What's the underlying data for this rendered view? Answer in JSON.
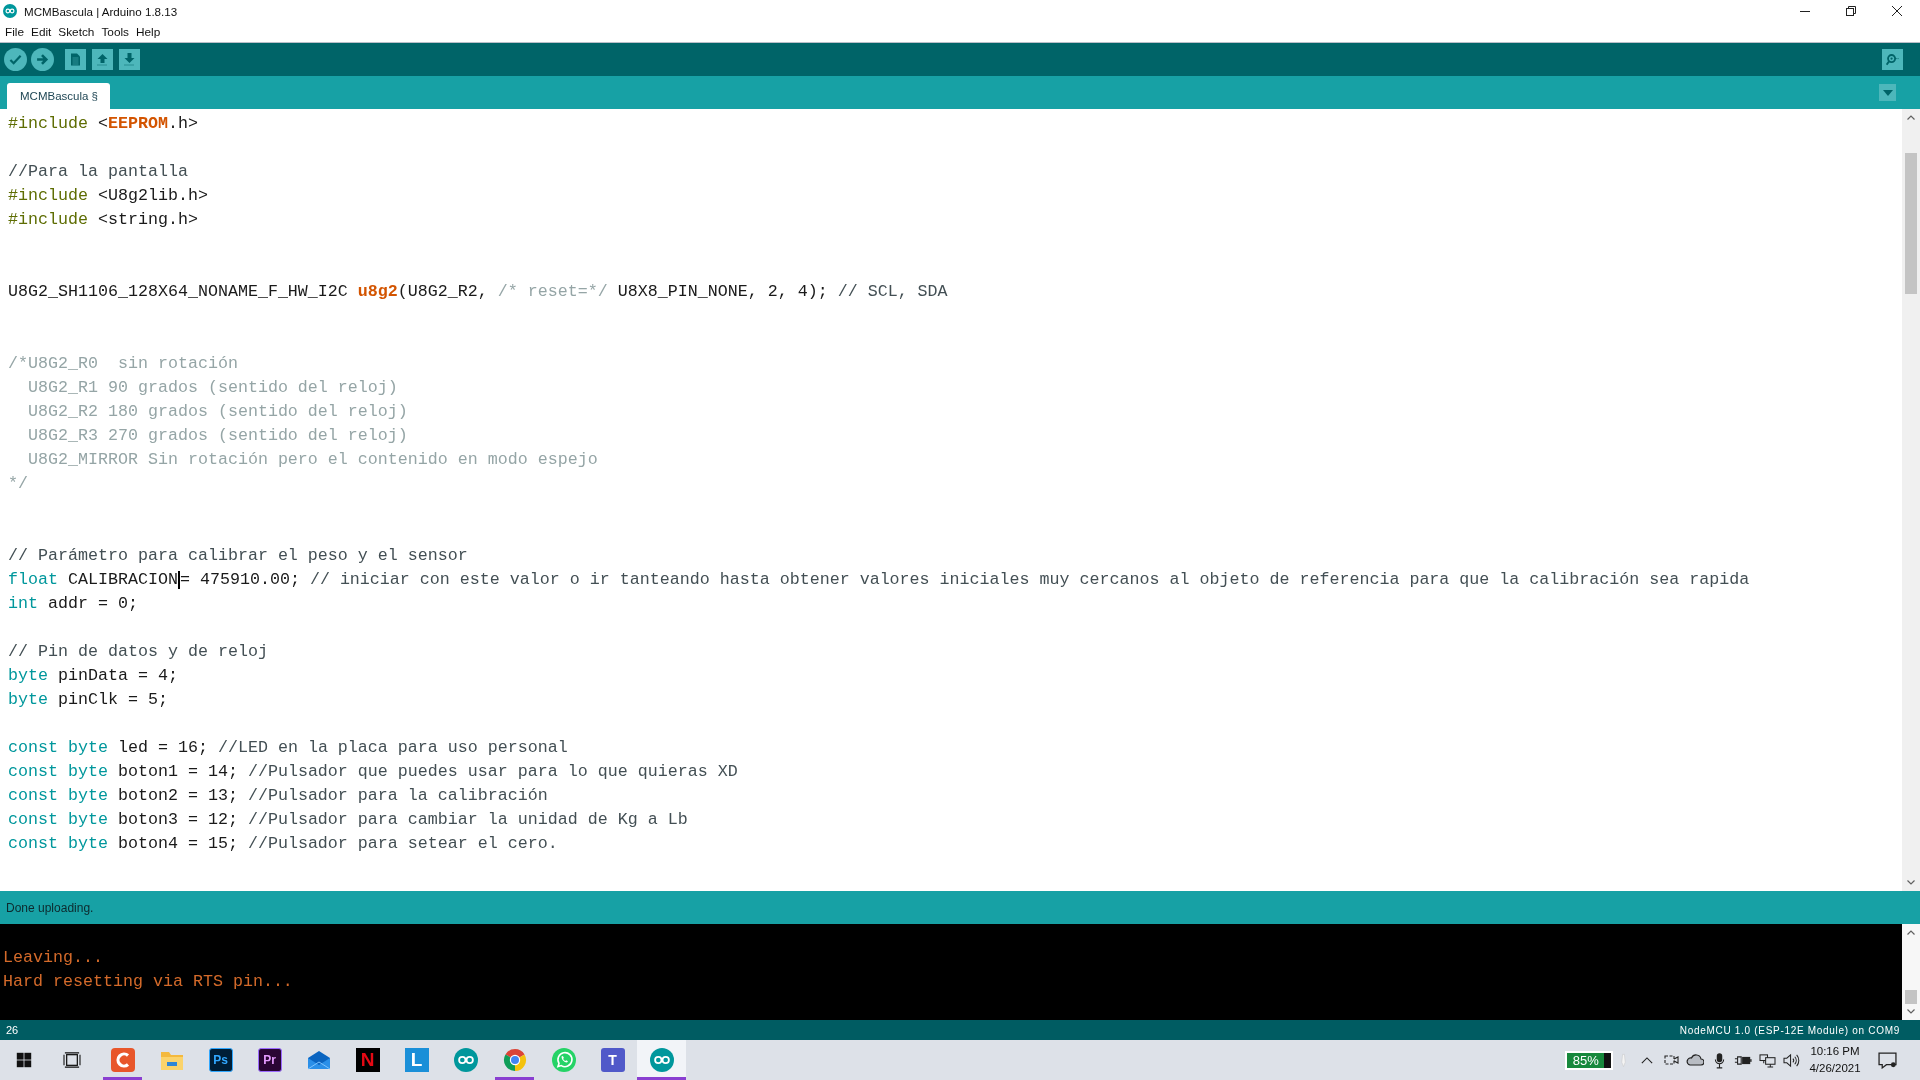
{
  "window": {
    "title": "MCMBascula | Arduino 1.8.13"
  },
  "menu": [
    "File",
    "Edit",
    "Sketch",
    "Tools",
    "Help"
  ],
  "tabs": [
    {
      "label": "MCMBascula §",
      "selected": true
    }
  ],
  "editor": {
    "lines": [
      {
        "kind": "code",
        "segments": [
          {
            "kind": "preprocessor",
            "text": "#include"
          },
          {
            "kind": "text",
            "text": " <"
          },
          {
            "kind": "emphasis",
            "text": "EEPROM"
          },
          {
            "kind": "text",
            "text": ".h>"
          }
        ]
      },
      {
        "kind": "blank"
      },
      {
        "kind": "code",
        "segments": [
          {
            "kind": "comment",
            "text": "//Para la pantalla"
          }
        ]
      },
      {
        "kind": "code",
        "segments": [
          {
            "kind": "preprocessor",
            "text": "#include"
          },
          {
            "kind": "text",
            "text": " <U8g2lib.h>"
          }
        ]
      },
      {
        "kind": "code",
        "segments": [
          {
            "kind": "preprocessor",
            "text": "#include"
          },
          {
            "kind": "text",
            "text": " <string.h>"
          }
        ]
      },
      {
        "kind": "blank"
      },
      {
        "kind": "blank"
      },
      {
        "kind": "code",
        "segments": [
          {
            "kind": "text",
            "text": "U8G2_SH1106_128X64_NONAME_F_HW_I2C "
          },
          {
            "kind": "emphasis",
            "text": "u8g2"
          },
          {
            "kind": "text",
            "text": "(U8G2_R2, "
          },
          {
            "kind": "block_comment",
            "text": "/* reset=*/"
          },
          {
            "kind": "text",
            "text": " U8X8_PIN_NONE, 2, 4); "
          },
          {
            "kind": "comment",
            "text": "// SCL, SDA"
          }
        ]
      },
      {
        "kind": "blank"
      },
      {
        "kind": "blank"
      },
      {
        "kind": "code",
        "segments": [
          {
            "kind": "block_comment",
            "text": "/*U8G2_R0  sin rotación"
          }
        ]
      },
      {
        "kind": "code",
        "segments": [
          {
            "kind": "block_comment",
            "text": "  U8G2_R1 90 grados (sentido del reloj)"
          }
        ]
      },
      {
        "kind": "code",
        "segments": [
          {
            "kind": "block_comment",
            "text": "  U8G2_R2 180 grados (sentido del reloj)"
          }
        ]
      },
      {
        "kind": "code",
        "segments": [
          {
            "kind": "block_comment",
            "text": "  U8G2_R3 270 grados (sentido del reloj)"
          }
        ]
      },
      {
        "kind": "code",
        "segments": [
          {
            "kind": "block_comment",
            "text": "  U8G2_MIRROR Sin rotación pero el contenido en modo espejo"
          }
        ]
      },
      {
        "kind": "code",
        "segments": [
          {
            "kind": "block_comment",
            "text": "*/"
          }
        ]
      },
      {
        "kind": "blank"
      },
      {
        "kind": "blank"
      },
      {
        "kind": "code",
        "segments": [
          {
            "kind": "comment",
            "text": "// Parámetro para calibrar el peso y el sensor"
          }
        ]
      },
      {
        "kind": "code",
        "segments": [
          {
            "kind": "type",
            "text": "float"
          },
          {
            "kind": "text",
            "text": " CALIBRACION"
          },
          {
            "kind": "caret"
          },
          {
            "kind": "text",
            "text": "= 475910.00; "
          },
          {
            "kind": "comment",
            "text": "// iniciar con este valor o ir tanteando hasta obtener valores iniciales muy cercanos al objeto de referencia para que la calibración sea rapida"
          }
        ]
      },
      {
        "kind": "code",
        "segments": [
          {
            "kind": "type",
            "text": "int"
          },
          {
            "kind": "text",
            "text": " addr = 0;"
          }
        ]
      },
      {
        "kind": "blank"
      },
      {
        "kind": "code",
        "segments": [
          {
            "kind": "comment",
            "text": "// Pin de datos y de reloj"
          }
        ]
      },
      {
        "kind": "code",
        "segments": [
          {
            "kind": "type",
            "text": "byte"
          },
          {
            "kind": "text",
            "text": " pinData = 4;"
          }
        ]
      },
      {
        "kind": "code",
        "segments": [
          {
            "kind": "type",
            "text": "byte"
          },
          {
            "kind": "text",
            "text": " pinClk = 5;"
          }
        ]
      },
      {
        "kind": "blank"
      },
      {
        "kind": "code",
        "segments": [
          {
            "kind": "type",
            "text": "const byte"
          },
          {
            "kind": "text",
            "text": " led = 16; "
          },
          {
            "kind": "comment",
            "text": "//LED en la placa para uso personal"
          }
        ]
      },
      {
        "kind": "code",
        "segments": [
          {
            "kind": "type",
            "text": "const byte"
          },
          {
            "kind": "text",
            "text": " boton1 = 14; "
          },
          {
            "kind": "comment",
            "text": "//Pulsador que puedes usar para lo que quieras XD"
          }
        ]
      },
      {
        "kind": "code",
        "segments": [
          {
            "kind": "type",
            "text": "const byte"
          },
          {
            "kind": "text",
            "text": " boton2 = 13; "
          },
          {
            "kind": "comment",
            "text": "//Pulsador para la calibración"
          }
        ]
      },
      {
        "kind": "code",
        "segments": [
          {
            "kind": "type",
            "text": "const byte"
          },
          {
            "kind": "text",
            "text": " boton3 = 12; "
          },
          {
            "kind": "comment",
            "text": "//Pulsador para cambiar la unidad de Kg a Lb"
          }
        ]
      },
      {
        "kind": "code",
        "segments": [
          {
            "kind": "type",
            "text": "const byte"
          },
          {
            "kind": "text",
            "text": " boton4 = 15; "
          },
          {
            "kind": "comment",
            "text": "//Pulsador para setear el cero."
          }
        ]
      }
    ]
  },
  "status": {
    "message": "Done uploading."
  },
  "console": {
    "lines": [
      "Leaving...",
      "Hard resetting via RTS pin..."
    ]
  },
  "status_bar": {
    "line": "26",
    "board": "NodeMCU 1.0 (ESP-12E Module) on COM9"
  },
  "taskbar": {
    "apps": [
      {
        "running": true,
        "active": false
      },
      {
        "running": false,
        "active": false
      },
      {
        "glyph": "Ps",
        "running": false,
        "active": false
      },
      {
        "glyph": "Pr",
        "running": false,
        "active": false
      },
      {
        "running": false,
        "active": false
      },
      {
        "glyph": "N",
        "running": false,
        "active": false
      },
      {
        "glyph": "L",
        "running": false,
        "active": false
      },
      {
        "running": false,
        "active": false
      },
      {
        "running": true,
        "active": false
      },
      {
        "running": false,
        "active": false
      },
      {
        "glyph": "T",
        "running": false,
        "active": false
      },
      {
        "running": true,
        "active": true
      }
    ],
    "battery": {
      "label": "85%",
      "level": 0.85
    },
    "clock": {
      "time": "10:16 PM",
      "date": "4/26/2021"
    }
  }
}
